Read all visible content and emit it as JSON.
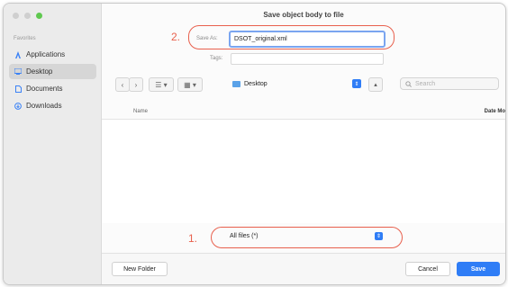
{
  "dialog": {
    "title": "Save object body to file"
  },
  "sidebar": {
    "section": "Favorites",
    "items": [
      {
        "label": "Applications",
        "icon": "applications-icon"
      },
      {
        "label": "Desktop",
        "icon": "desktop-icon",
        "selected": true
      },
      {
        "label": "Documents",
        "icon": "documents-icon"
      },
      {
        "label": "Downloads",
        "icon": "downloads-icon"
      }
    ]
  },
  "annotations": {
    "step1": "1.",
    "step2": "2.",
    "color": "#e8604d"
  },
  "save_as": {
    "label": "Save As:",
    "value": "DSOT_original.xml"
  },
  "tags": {
    "label": "Tags:",
    "value": ""
  },
  "toolbar": {
    "back": "‹",
    "forward": "›",
    "list_view": "☰ ▾",
    "grid_view": "▦ ▾",
    "location": "Desktop",
    "expand": "▴",
    "search_placeholder": "Search"
  },
  "list": {
    "columns": [
      "Name",
      "Date Mo"
    ],
    "rows": []
  },
  "format": {
    "value": "All files (*)"
  },
  "footer": {
    "new_folder": "New Folder",
    "cancel": "Cancel",
    "save": "Save"
  },
  "colors": {
    "accent": "#2f7df6",
    "annotation": "#e8604d"
  }
}
